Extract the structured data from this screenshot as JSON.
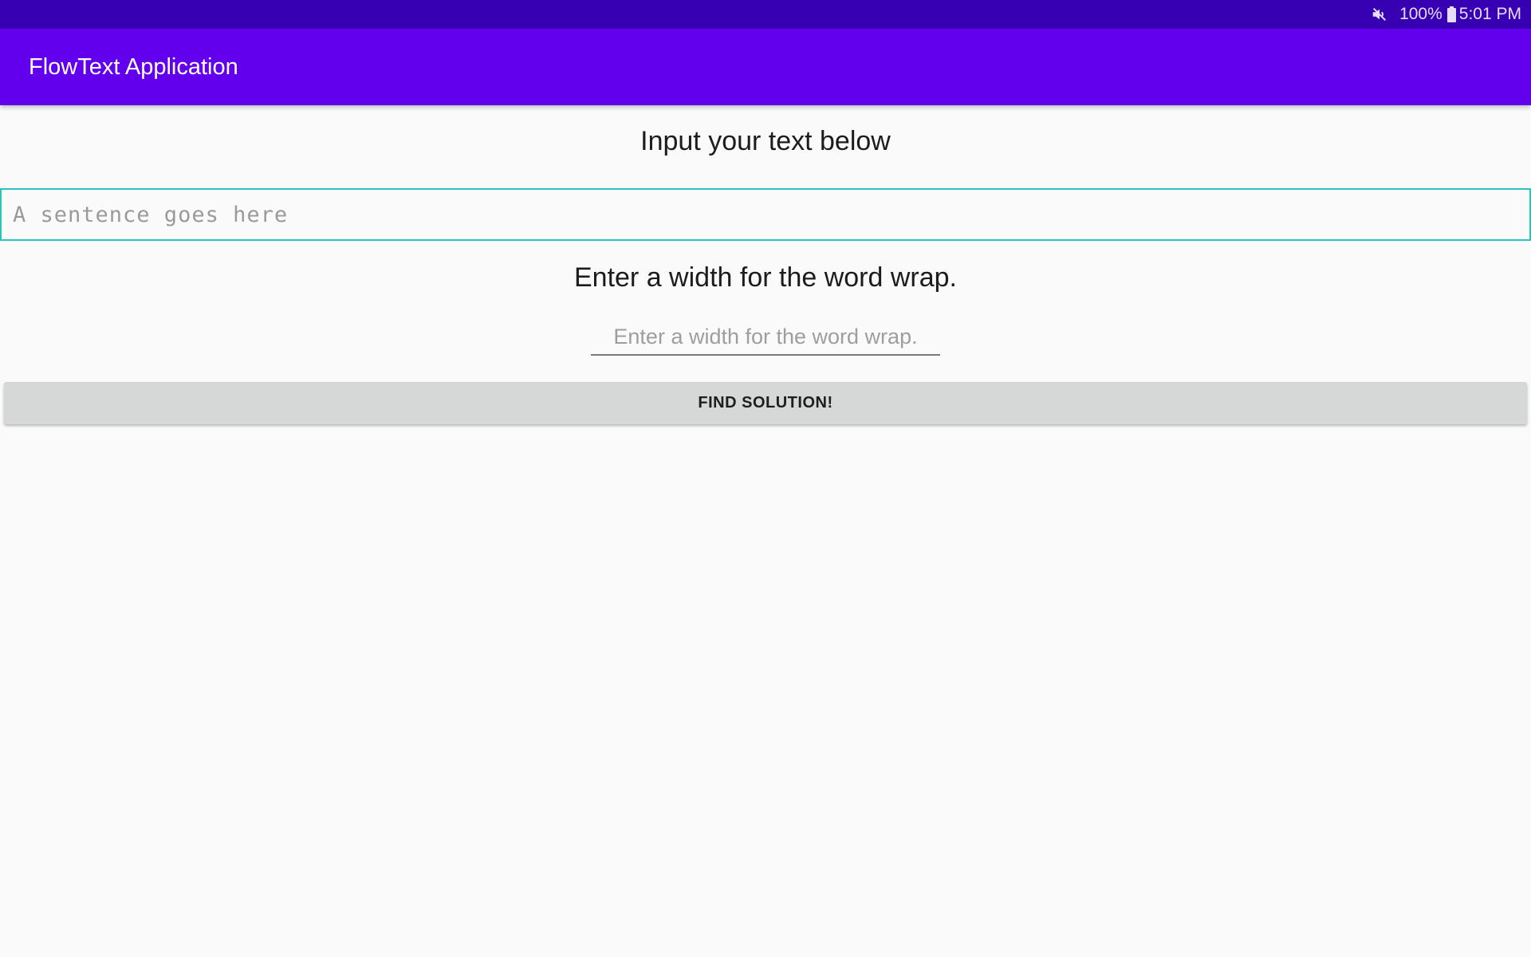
{
  "status_bar": {
    "battery": "100%",
    "time": "5:01 PM",
    "icons": [
      "mute-icon",
      "battery-icon"
    ]
  },
  "app_bar": {
    "title": "FlowText Application"
  },
  "main": {
    "input_heading": "Input your text below",
    "sentence_input": {
      "value": "",
      "placeholder": "A sentence goes here"
    },
    "width_heading": "Enter a width for the word wrap.",
    "width_input": {
      "value": "",
      "placeholder": "Enter a width for the word wrap."
    },
    "find_button_label": "FIND SOLUTION!"
  },
  "colors": {
    "status_bar": "#3700B3",
    "app_bar": "#6200EE",
    "input_focus_border": "#26C6BD",
    "button": "#D6D7D7",
    "background": "#FAFAFA"
  }
}
